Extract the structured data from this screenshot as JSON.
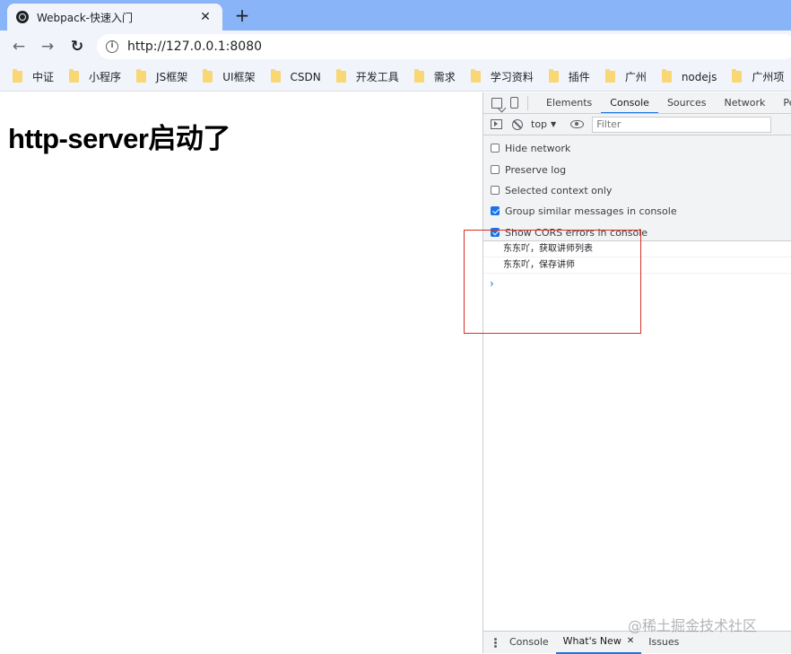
{
  "browser": {
    "tab": {
      "title": "Webpack-快速入门",
      "close": "✕"
    },
    "new_tab": "+",
    "nav": {
      "back": "←",
      "forward": "→",
      "reload": "↻"
    },
    "address": {
      "info": "i",
      "url": "http://127.0.0.1:8080"
    },
    "bookmarks": [
      "中证",
      "小程序",
      "JS框架",
      "UI框架",
      "CSDN",
      "开发工具",
      "需求",
      "学习资料",
      "插件",
      "广州",
      "nodejs",
      "广州项"
    ]
  },
  "page": {
    "heading": "http-server启动了"
  },
  "devtools": {
    "tabs": [
      "Elements",
      "Console",
      "Sources",
      "Network",
      "Performance"
    ],
    "active_tab": "Console",
    "filter_bar": {
      "context": "top",
      "context_arrow": "▼",
      "filter_placeholder": "Filter"
    },
    "settings": [
      {
        "label": "Hide network",
        "checked": false
      },
      {
        "label": "Preserve log",
        "checked": false
      },
      {
        "label": "Selected context only",
        "checked": false
      },
      {
        "label": "Group similar messages in console",
        "checked": true
      },
      {
        "label": "Show CORS errors in console",
        "checked": true
      }
    ],
    "logs": [
      "东东吖，获取讲师列表",
      "东东吖，保存讲师"
    ],
    "prompt": "›",
    "drawer": {
      "tabs": [
        "Console",
        "What's New",
        "Issues"
      ],
      "active": "What's New",
      "close": "✕"
    }
  },
  "annotation": {
    "color": "#d93025"
  },
  "watermark": "@稀土掘金技术社区",
  "colors": {
    "tab_strip": "#8ab4f8",
    "toolbar": "#f1f5fb",
    "accent": "#1a73e8"
  }
}
